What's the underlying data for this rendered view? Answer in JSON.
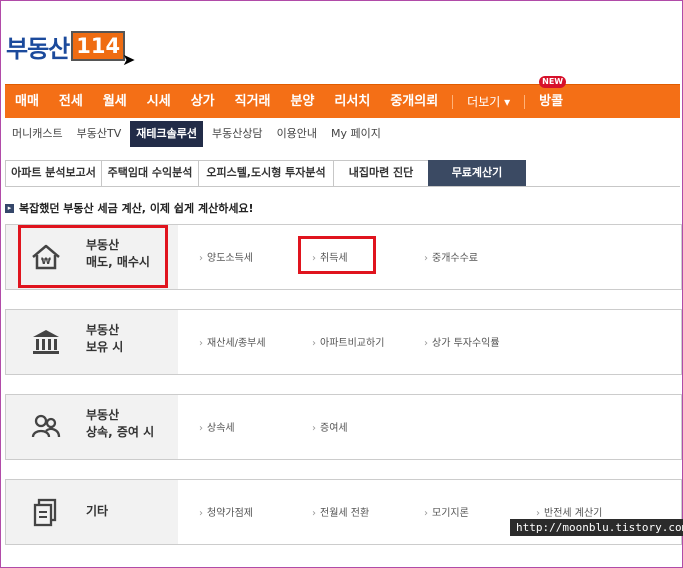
{
  "logo": {
    "text": "부동산",
    "box": "114"
  },
  "gnb": {
    "items": [
      "매매",
      "전세",
      "월세",
      "시세",
      "상가",
      "직거래",
      "분양",
      "리서치",
      "중개의뢰"
    ],
    "more_label": "더보기 ▾",
    "banggol": "방콜",
    "new_badge": "NEW"
  },
  "sub_nav": {
    "items": [
      "머니캐스트",
      "부동산TV",
      "재테크솔루션",
      "부동산상담",
      "이용안내",
      "My 페이지"
    ],
    "active": "재테크솔루션"
  },
  "tabs": {
    "items": [
      "아파트 분석보고서",
      "주택임대 수익분석",
      "오피스텔,도시형 투자분석",
      "내집마련 진단",
      "무료계산기"
    ],
    "active": "무료계산기"
  },
  "notice": "복잡했던 부동산 세금 계산, 이제 쉽게 계산하세요!",
  "categories": [
    {
      "title1": "부동산",
      "title2": "매도, 매수시",
      "icon": "house-won-icon",
      "links": [
        "양도소득세",
        "취득세",
        "중개수수료"
      ]
    },
    {
      "title1": "부동산",
      "title2": "보유 시",
      "icon": "bank-building-icon",
      "links": [
        "재산세/종부세",
        "아파트비교하기",
        "상가 투자수익률"
      ]
    },
    {
      "title1": "부동산",
      "title2": "상속, 증여 시",
      "icon": "family-icon",
      "links": [
        "상속세",
        "증여세"
      ]
    },
    {
      "title1": "기타",
      "title2": "",
      "icon": "document-copy-icon",
      "links": [
        "청약가점제",
        "전월세 전환",
        "모기지론",
        "반전세 계산기"
      ]
    }
  ],
  "watermark": "http://moonblu.tistory.com",
  "colors": {
    "accent": "#f46f16",
    "active_tab": "#3b4a63",
    "highlight": "#e0141e",
    "logo": "#1b4a9c"
  }
}
